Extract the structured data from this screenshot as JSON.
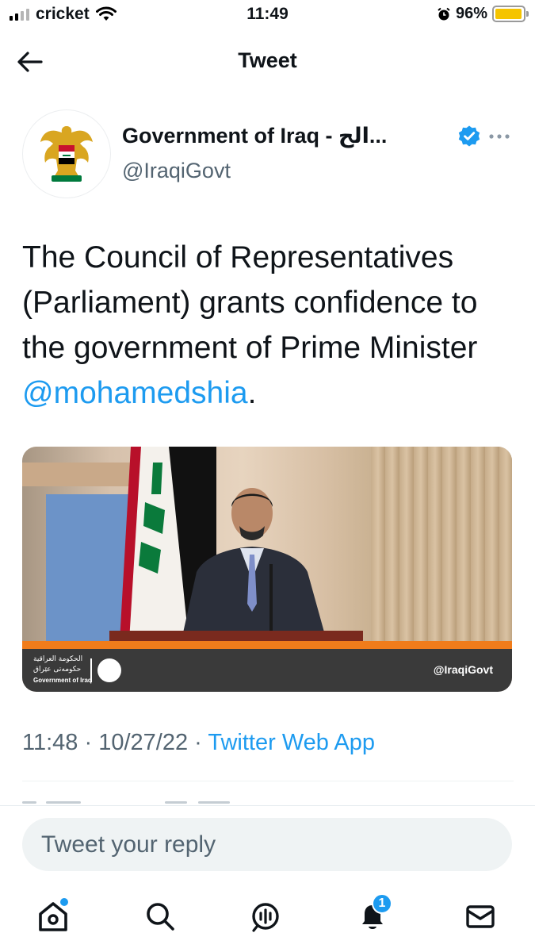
{
  "status_bar": {
    "carrier": "cricket",
    "time": "11:49",
    "battery_percent": "96%",
    "battery_level": 0.96,
    "battery_color": "#f5c400"
  },
  "header": {
    "title": "Tweet",
    "back_icon": "arrow-left-icon"
  },
  "author": {
    "name": "Government of Iraq - الح...",
    "handle": "@IraqiGovt",
    "verified": true,
    "avatar_icon": "iraq-coat-of-arms"
  },
  "tweet": {
    "text_before": "The Council of Representatives (Parliament) grants confidence to the government of Prime Minister ",
    "mention": "@mohamedshia",
    "text_after": ".",
    "media": {
      "footer_arabic_line1": "الحكومة العراقية",
      "footer_arabic_line2": "حكومەتی عێراق",
      "footer_english": "Government of Iraq",
      "footer_handle": "@IraqiGovt"
    },
    "time": "11:48",
    "date": "10/27/22",
    "source": "Twitter Web App"
  },
  "reply": {
    "placeholder": "Tweet your reply"
  },
  "tab_bar": {
    "items": [
      {
        "name": "home",
        "icon": "home-icon",
        "has_dot": true
      },
      {
        "name": "search",
        "icon": "search-icon"
      },
      {
        "name": "spaces",
        "icon": "spaces-icon"
      },
      {
        "name": "notifications",
        "icon": "bell-icon",
        "badge": "1"
      },
      {
        "name": "messages",
        "icon": "mail-icon"
      }
    ]
  },
  "colors": {
    "accent": "#1d9bf0",
    "text": "#0f1419",
    "secondary": "#536471"
  }
}
